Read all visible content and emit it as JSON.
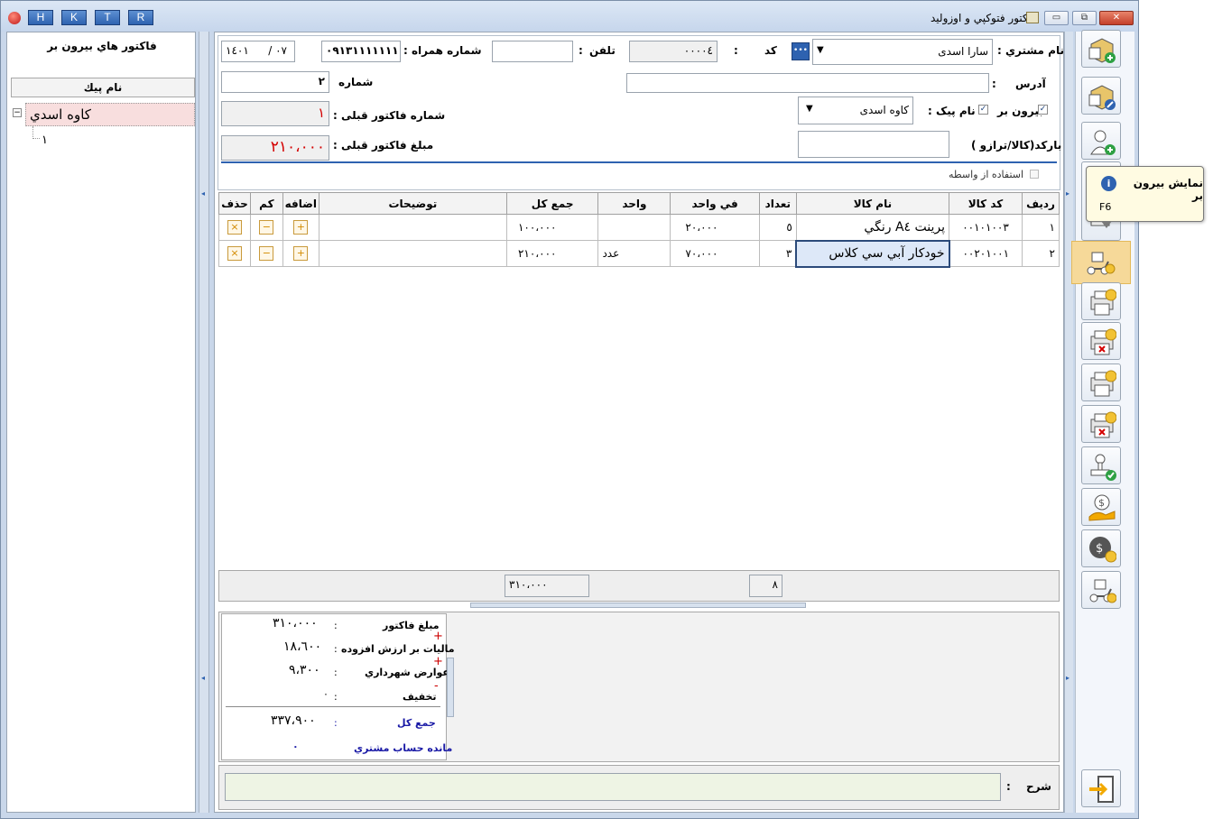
{
  "titlebar": {
    "title": "فاكتور فتوكپي و اوزوليد",
    "quick_buttons": [
      "H",
      "K",
      "T",
      "R"
    ]
  },
  "left_panel": {
    "heading": "فاكتور هاي بيرون بر",
    "column_header": "نام پيك",
    "tree": {
      "root_label": "كاوه اسدي",
      "expander": "−",
      "child_label": "١"
    }
  },
  "form": {
    "date": {
      "year": "١٤٠١",
      "month": "/ ٠٧"
    },
    "mobile_label": "شماره همراه :",
    "mobile_value": "٠٩١٣١١١١١١١",
    "phone_label": "تلفن",
    "phone_value": "",
    "code_label": "كد",
    "code_value": "٠٠٠٠٤",
    "colon": ":",
    "customer_label": "نام مشتري :",
    "customer_value": "سارا اسدی",
    "more_button": "•••",
    "number_label": "شماره",
    "number_value": "٢",
    "address_label": "آدرس",
    "address_value": "",
    "prev_invoice_no_label": "شماره فاكتور قبلی :",
    "prev_invoice_no_value": "١",
    "outbound_label": "بيرون بر",
    "outbound_checked": true,
    "courier_label": "نام پيک :",
    "courier_checked": true,
    "courier_value": "كاوه اسدی",
    "prev_invoice_amount_label": "مبلغ فاكتور قبلی :",
    "prev_invoice_amount_value": "٢١٠،٠٠٠",
    "barcode_label": "باركد(كالا/ترازو )",
    "barcode_value": "",
    "intermediary_label": "استفاده از واسطه",
    "intermediary_checked": false
  },
  "grid": {
    "headers": {
      "row": "رديف",
      "code": "كد كالا",
      "name": "نام كالا",
      "qty": "تعداد",
      "unit_price": "في واحد",
      "unit": "واحد",
      "total": "جمع كل",
      "desc": "توضيحات",
      "add": "اضافه",
      "minus": "كم",
      "delete": "حذف"
    },
    "rows": [
      {
        "row": "١",
        "code": "٠٠١٠١٠٠٣",
        "name": "پرينت A٤ رنگي",
        "qty": "٥",
        "unit_price": "٢٠،٠٠٠",
        "unit": "",
        "total": "١٠٠،٠٠٠",
        "desc": ""
      },
      {
        "row": "٢",
        "code": "٠٠٢٠١٠٠١",
        "name": "خودكار آبي سي كلاس",
        "qty": "٣",
        "unit_price": "٧٠،٠٠٠",
        "unit": "عدد",
        "total": "٢١٠،٠٠٠",
        "desc": ""
      }
    ],
    "button_glyphs": {
      "add": "+",
      "minus": "−",
      "delete": "×"
    },
    "footer_total": "٣١٠،٠٠٠",
    "footer_qty": "٨"
  },
  "summary": {
    "invoice_amount_label": "مبلغ فاكتور",
    "invoice_amount": "٣١٠،٠٠٠",
    "vat_label": "ماليات بر ارزش افزوده",
    "vat": "١٨،٦٠٠",
    "municipal_label": "عوارض شهرداري",
    "municipal": "٩،٣٠٠",
    "discount_label": "تخفيف",
    "discount": "٠",
    "grand_total_label": "جمع كل",
    "grand_total": "٣٣٧،٩٠٠",
    "balance_label": "مانده حساب مشتري",
    "balance": "٠",
    "colon": ":",
    "plus": "+",
    "minus": "-"
  },
  "notes": {
    "label": "شرح",
    "colon": ":",
    "value": ""
  },
  "tooltip": {
    "title": "نمايش بيرون بر",
    "shortcut": "F6"
  },
  "colors": {
    "accent_blue": "#2e62b0",
    "red_text": "#d40000",
    "highlight": "#f6d999",
    "summary_blue": "#1a1aa6"
  }
}
